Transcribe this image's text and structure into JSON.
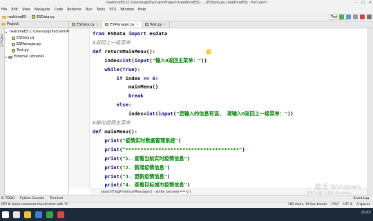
{
  "window": {
    "title": "realtimeES [C:\\Users\\ygl\\PycharmProjects\\realtimeES] - ...\\ESData.py [realtimeES] - PyCharm",
    "controls": [
      "–",
      "□",
      "×"
    ]
  },
  "menu": [
    "File",
    "Edit",
    "View",
    "Navigate",
    "Code",
    "Refactor",
    "Run",
    "Tools",
    "VCS",
    "Window",
    "Help"
  ],
  "navbar": {
    "crumbs": [
      "realtimeES",
      "ESData.py"
    ],
    "run_config": "Test"
  },
  "tabs": {
    "project_label": "Project",
    "files": [
      "ESData.py",
      "ESManager.py",
      "Test.py"
    ],
    "active": 1
  },
  "project_tree": {
    "root": "realtimeES  C:\\Users\\ygl\\PycharmProjects\\re",
    "files": [
      "ESData.py",
      "ESManager.py",
      "Test.py"
    ],
    "external": "External Libraries"
  },
  "left_strip": {
    "label": "1: Project"
  },
  "code_lines": [
    [
      [
        "kw",
        "from "
      ],
      [
        "t",
        "ESData "
      ],
      [
        "kw",
        "import "
      ],
      [
        "t",
        "esdata"
      ]
    ],
    [
      [
        "cmt",
        "#返回上一级菜单"
      ]
    ],
    [
      [
        "kw",
        "def "
      ],
      [
        "t",
        "returnMainMenu():"
      ]
    ],
    [
      [
        "t",
        "    index="
      ],
      [
        "bi",
        "int"
      ],
      [
        "t",
        "("
      ],
      [
        "bi",
        "input"
      ],
      [
        "t",
        "("
      ],
      [
        "str",
        "\"输入0返回主菜单：\""
      ],
      [
        "t",
        "))"
      ]
    ],
    [
      [
        "t",
        "    "
      ],
      [
        "kw",
        "while"
      ],
      [
        "t",
        "("
      ],
      [
        "kw",
        "True"
      ],
      [
        "t",
        "):"
      ]
    ],
    [
      [
        "t",
        "        "
      ],
      [
        "kw",
        "if "
      ],
      [
        "t",
        "index == "
      ],
      [
        "num",
        "0"
      ],
      [
        "t",
        ":"
      ]
    ],
    [
      [
        "t",
        "            mainMenu()"
      ]
    ],
    [
      [
        "t",
        "            "
      ],
      [
        "kw",
        "break"
      ]
    ],
    [
      [
        "t",
        "        "
      ],
      [
        "kw",
        "else"
      ],
      [
        "t",
        ":"
      ]
    ],
    [
      [
        "t",
        "            index="
      ],
      [
        "bi",
        "int"
      ],
      [
        "t",
        "("
      ],
      [
        "bi",
        "input"
      ],
      [
        "t",
        "("
      ],
      [
        "str",
        "\"您输入的信息有误， 请输入0返回上一级菜单：\""
      ],
      [
        "t",
        "))"
      ]
    ],
    [
      [
        "cmt",
        "#输出疫情主菜单"
      ]
    ],
    [
      [
        "kw",
        "def "
      ],
      [
        "t",
        "mainMenu():"
      ]
    ],
    [
      [
        "t",
        "    "
      ],
      [
        "bi",
        "print"
      ],
      [
        "t",
        "("
      ],
      [
        "str",
        "\"疫情实时数据管理系统\""
      ],
      [
        "t",
        ")"
      ]
    ],
    [
      [
        "t",
        "    "
      ],
      [
        "bi",
        "print"
      ],
      [
        "t",
        "("
      ],
      [
        "str",
        "\"**************************************\""
      ],
      [
        "t",
        ")"
      ]
    ],
    [
      [
        "t",
        "    "
      ],
      [
        "bi",
        "print"
      ],
      [
        "t",
        "("
      ],
      [
        "str",
        "\"1. 查看当前实时疫情信息\""
      ],
      [
        "t",
        ")"
      ]
    ],
    [
      [
        "t",
        "    "
      ],
      [
        "bi",
        "print"
      ],
      [
        "t",
        "("
      ],
      [
        "str",
        "\"2. 新增疫情信息\""
      ],
      [
        "t",
        ")"
      ]
    ],
    [
      [
        "t",
        "    "
      ],
      [
        "bi",
        "print"
      ],
      [
        "t",
        "("
      ],
      [
        "str",
        "\"3. 更新疫情信息\""
      ],
      [
        "t",
        ")"
      ]
    ],
    [
      [
        "t",
        "    "
      ],
      [
        "bi",
        "print"
      ],
      [
        "t",
        "("
      ],
      [
        "str",
        "\"4. 查看目标城市疫情信息\""
      ],
      [
        "t",
        ")"
      ]
    ],
    [
      [
        "t",
        "    "
      ],
      [
        "bi",
        "print"
      ],
      [
        "t",
        "("
      ],
      [
        "str",
        "\"5. 退  出\""
      ],
      [
        "t",
        ")"
      ]
    ]
  ],
  "editor_breadcrumb": "searchFlagProvinceMessage()  ›  while (answer=='y')",
  "bottom_tabs": [
    "6: TODO",
    "Python Console",
    "Terminal"
  ],
  "event_log": "Event Log",
  "status": {
    "message": "PEP 8: block comment should start with '# '",
    "position": "169 chars, 10 line breaks",
    "line_sep": "CRLF",
    "encoding": "UTF-8",
    "indent": "4 spaces"
  },
  "watermark": {
    "line1": "激活 Windows",
    "line2": "转到\"设置\"以激活 Windows。"
  },
  "clock": "2020/"
}
